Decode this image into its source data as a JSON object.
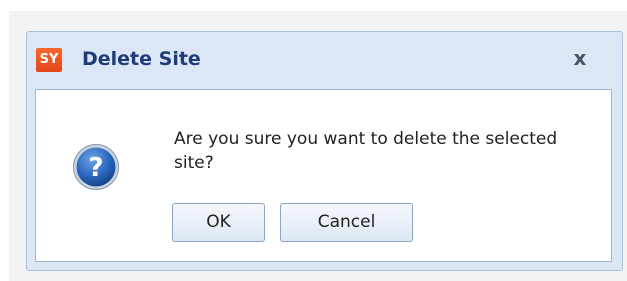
{
  "dialog": {
    "app_icon_text": "SY",
    "title": "Delete Site",
    "close_label": "x",
    "message": "Are you sure you want to delete the selected site?",
    "ok_label": "OK",
    "cancel_label": "Cancel",
    "icon": "question-icon"
  },
  "colors": {
    "title_text": "#1f3c7a",
    "app_icon_bg": "#e8501f",
    "dialog_bg": "#dbe7f5",
    "question_icon": "#1f5fb0"
  }
}
